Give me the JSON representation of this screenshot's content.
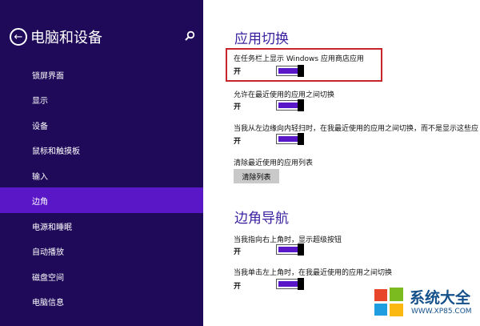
{
  "sidebar": {
    "title": "电脑和设备",
    "items": [
      {
        "label": "锁屏界面",
        "active": false
      },
      {
        "label": "显示",
        "active": false
      },
      {
        "label": "设备",
        "active": false
      },
      {
        "label": "鼠标和触摸板",
        "active": false
      },
      {
        "label": "输入",
        "active": false
      },
      {
        "label": "边角",
        "active": true
      },
      {
        "label": "电源和睡眠",
        "active": false
      },
      {
        "label": "自动播放",
        "active": false
      },
      {
        "label": "磁盘空间",
        "active": false
      },
      {
        "label": "电脑信息",
        "active": false
      }
    ]
  },
  "main": {
    "section_app_switch": "应用切换",
    "setting_taskbar_store": {
      "label": "在任务栏上显示 Windows 应用商店应用",
      "state": "开"
    },
    "setting_recent_switch": {
      "label": "允许在最近使用的应用之间切换",
      "state": "开"
    },
    "setting_left_swipe": {
      "label": "当我从左边缘向内轻扫时，在我最近使用的应用之间切换，而不是显示这些应",
      "state": "开"
    },
    "clear_recent": {
      "label": "清除最近使用的应用列表",
      "button": "清除列表"
    },
    "section_corner_nav": "边角导航",
    "setting_top_right": {
      "label": "当我指向右上角时，显示超级按钮",
      "state": "开"
    },
    "setting_top_left": {
      "label": "当我单击左上角时，在我最近使用的应用之间切换",
      "state": "开"
    }
  },
  "watermark": {
    "name": "系统大全",
    "url": "WWW.XP85.COM"
  },
  "colors": {
    "sidebar_bg": "#1f0a5a",
    "accent": "#5a17c8",
    "heading": "#3b1fa1",
    "highlight": "#c8242b"
  }
}
